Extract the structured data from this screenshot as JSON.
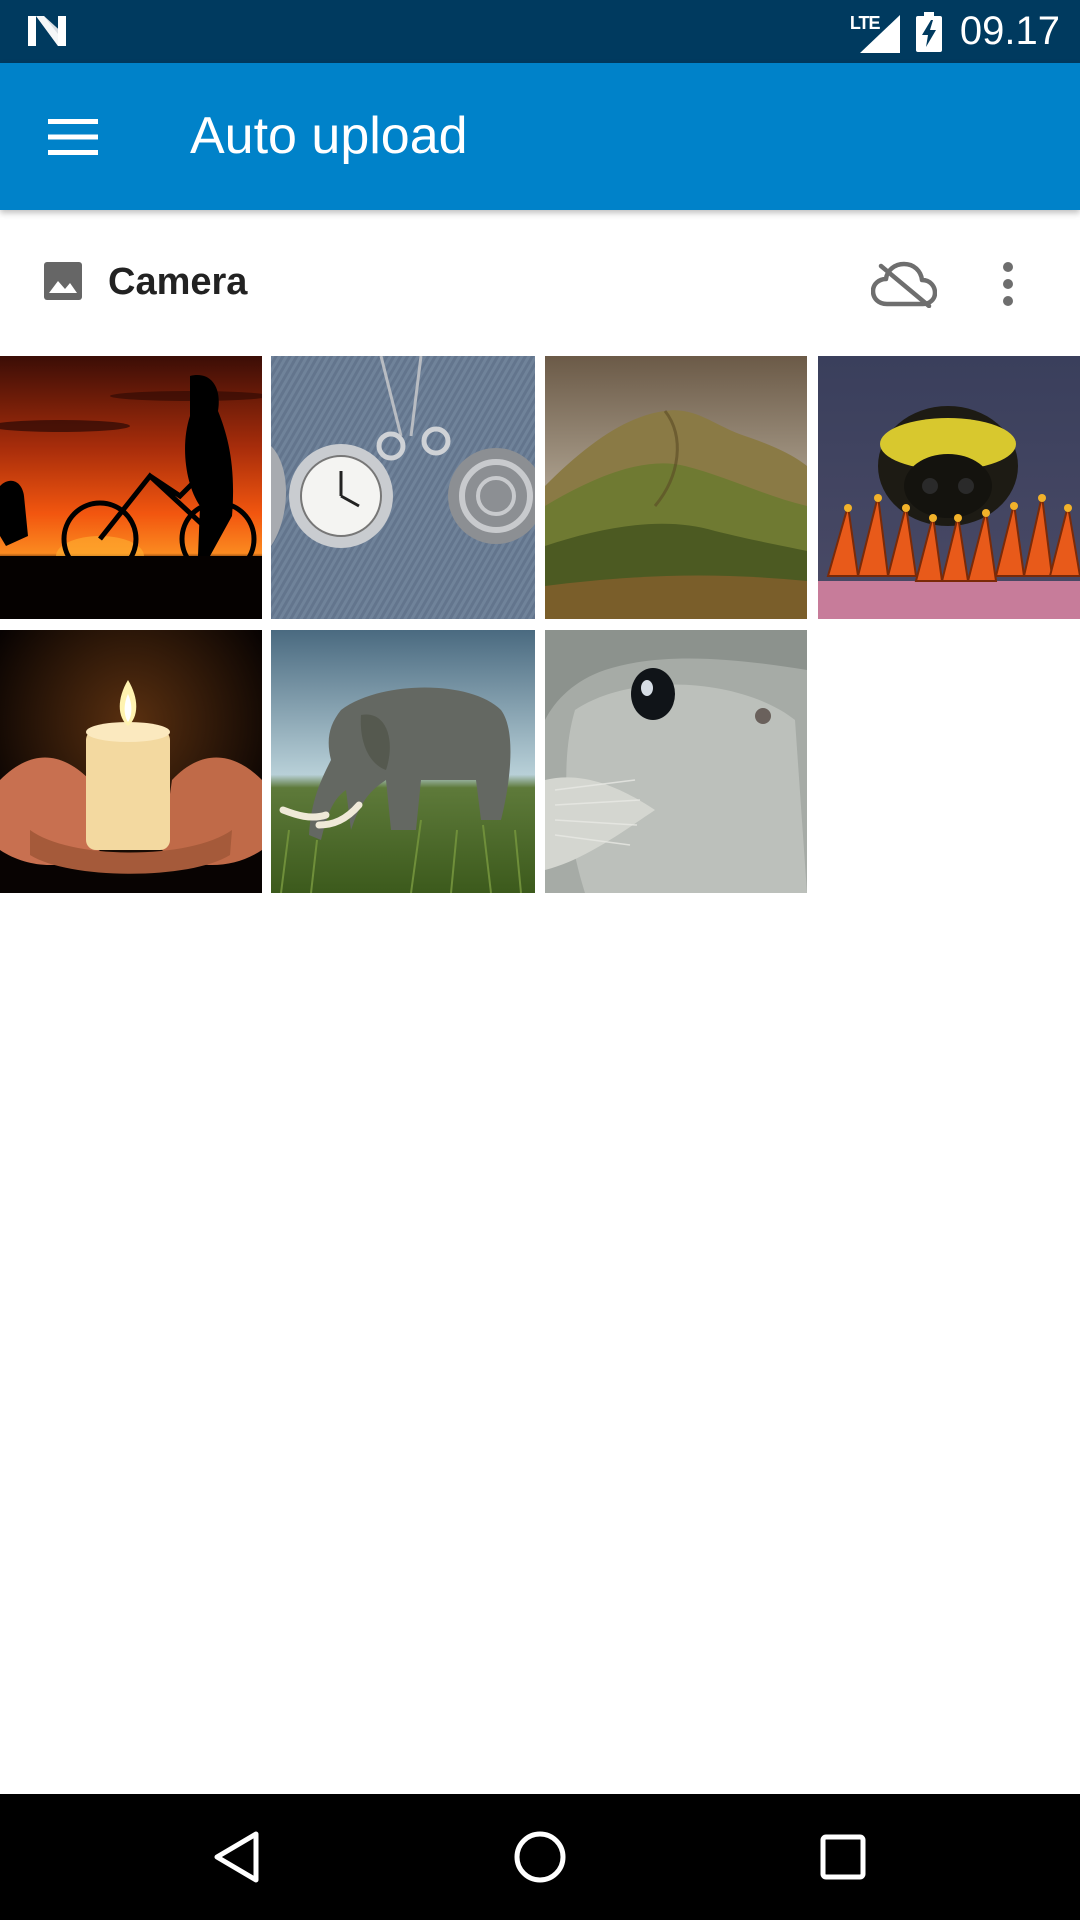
{
  "status_bar": {
    "network_label": "LTE",
    "time": "09.17"
  },
  "app_bar": {
    "title": "Auto upload"
  },
  "folder": {
    "name": "Camera"
  },
  "thumbnails": [
    {
      "subject": "Silhouette with bicycle at sunset"
    },
    {
      "subject": "Pocket watches on denim"
    },
    {
      "subject": "Green rolling hills"
    },
    {
      "subject": "Bumblebee on flower"
    },
    {
      "subject": "Candle held in hands"
    },
    {
      "subject": "Elephant in grass"
    },
    {
      "subject": "Seal close-up"
    }
  ],
  "icons": {
    "notification": "n-logo-icon",
    "signal": "signal-icon",
    "battery": "battery-charging-icon",
    "menu": "hamburger-menu-icon",
    "folder": "image-icon",
    "cloud": "cloud-off-icon",
    "overflow": "more-vert-icon",
    "back": "back-icon",
    "home": "home-icon",
    "recents": "recents-icon"
  },
  "colors": {
    "status_bar": "#003a5f",
    "app_bar": "#0082c9",
    "nav_bar": "#000000"
  }
}
